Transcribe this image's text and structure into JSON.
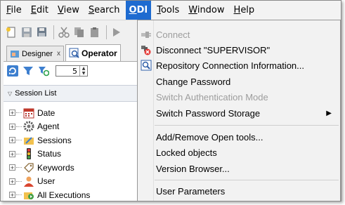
{
  "menubar": {
    "items": [
      {
        "label": "File",
        "ul": "F",
        "rest": "ile"
      },
      {
        "label": "Edit",
        "ul": "E",
        "rest": "dit"
      },
      {
        "label": "View",
        "ul": "V",
        "rest": "iew"
      },
      {
        "label": "Search",
        "ul": "S",
        "rest": "earch"
      },
      {
        "label": "ODI",
        "ul": "O",
        "rest": "DI"
      },
      {
        "label": "Tools",
        "ul": "T",
        "rest": "ools"
      },
      {
        "label": "Window",
        "ul": "W",
        "rest": "indow"
      },
      {
        "label": "Help",
        "ul": "H",
        "rest": "elp"
      }
    ]
  },
  "tabs": {
    "designer": "Designer",
    "designer_close": "x",
    "operator": "Operator"
  },
  "spinner": {
    "value": "5"
  },
  "section": {
    "title": "Session List"
  },
  "tree": {
    "items": [
      {
        "label": "Date",
        "icon": "calendar-icon"
      },
      {
        "label": "Agent",
        "icon": "gear-agent-icon"
      },
      {
        "label": "Sessions",
        "icon": "sessions-icon"
      },
      {
        "label": "Status",
        "icon": "traffic-light-icon"
      },
      {
        "label": "Keywords",
        "icon": "tag-icon"
      },
      {
        "label": "User",
        "icon": "user-icon"
      },
      {
        "label": "All Executions",
        "icon": "executions-icon"
      }
    ]
  },
  "odi_menu": {
    "connect": "Connect",
    "disconnect": "Disconnect \"SUPERVISOR\"",
    "repo_info": "Repository Connection Information...",
    "change_password": "Change Password",
    "switch_auth": "Switch Authentication Mode",
    "switch_pw_storage": "Switch Password Storage",
    "add_remove_tools": "Add/Remove Open tools...",
    "locked_objects": "Locked objects",
    "version_browser": "Version Browser...",
    "user_parameters": "User Parameters"
  },
  "colors": {
    "menu_active": "#1e6bd0",
    "disabled_text": "#9d9d9d"
  }
}
